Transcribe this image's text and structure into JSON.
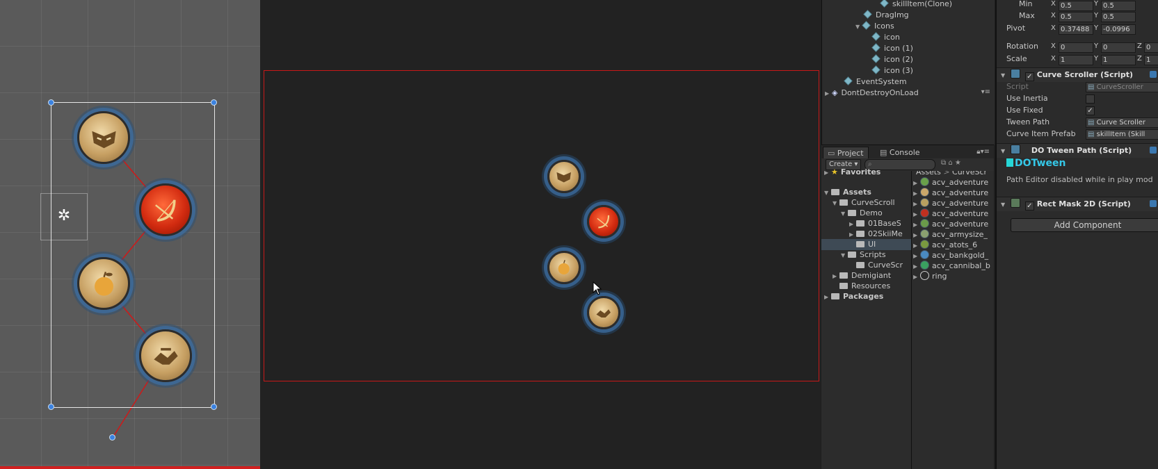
{
  "hierarchy": {
    "items": [
      {
        "label": "skillItem(Clone)",
        "icon": "cube-icon"
      },
      {
        "label": "DragImg",
        "icon": "cube-icon"
      },
      {
        "label": "Icons",
        "icon": "cube-icon"
      },
      {
        "label": "icon",
        "icon": "cube-icon"
      },
      {
        "label": "icon (1)",
        "icon": "cube-icon"
      },
      {
        "label": "icon (2)",
        "icon": "cube-icon"
      },
      {
        "label": "icon (3)",
        "icon": "cube-icon"
      },
      {
        "label": "EventSystem",
        "icon": "cube-icon"
      },
      {
        "label": "DontDestroyOnLoad",
        "icon": "unity-scene-icon"
      }
    ]
  },
  "project": {
    "tabs": [
      "Project",
      "Console"
    ],
    "create_label": "Create",
    "favorites": "Favorites",
    "tree": [
      {
        "label": "Assets",
        "bold": true
      },
      {
        "label": "CurveScroll"
      },
      {
        "label": "Demo"
      },
      {
        "label": "01BaseS"
      },
      {
        "label": "02SkiiMe"
      },
      {
        "label": "UI",
        "selected": true
      },
      {
        "label": "Scripts"
      },
      {
        "label": "CurveScr"
      },
      {
        "label": "Demigiant"
      },
      {
        "label": "Resources"
      },
      {
        "label": "Packages",
        "bold": true
      }
    ],
    "breadcrumb": [
      "Assets",
      "CurveScr"
    ],
    "files": [
      {
        "label": "acv_adventure",
        "color": "#6aa04a"
      },
      {
        "label": "acv_adventure",
        "color": "#c9a76a"
      },
      {
        "label": "acv_adventure",
        "color": "#b8a060"
      },
      {
        "label": "acv_adventure",
        "color": "#c03020"
      },
      {
        "label": "acv_adventure",
        "color": "#6a9a4a"
      },
      {
        "label": "acv_armysize_",
        "color": "#8aa070"
      },
      {
        "label": "acv_atots_6",
        "color": "#7a9a40"
      },
      {
        "label": "acv_bankgold_",
        "color": "#4a8ac0"
      },
      {
        "label": "acv_cannibal_b",
        "color": "#3aa060"
      },
      {
        "label": "ring",
        "color": "#2b2b2b"
      }
    ]
  },
  "inspector": {
    "min_label": "Min",
    "min_x": "0.5",
    "min_y": "0.5",
    "max_label": "Max",
    "max_x": "0.5",
    "max_y": "0.5",
    "pivot_label": "Pivot",
    "pivot_x": "0.37488",
    "pivot_y": "-0.0996",
    "rotation_label": "Rotation",
    "rot_x": "0",
    "rot_y": "0",
    "rot_z": "0",
    "scale_label": "Scale",
    "scale_x": "1",
    "scale_y": "1",
    "scale_z": "1",
    "axis_x": "X",
    "axis_y": "Y",
    "axis_z": "Z",
    "curve_scroller": {
      "title": "Curve Scroller (Script)",
      "script_label": "Script",
      "script_value": "CurveScroller",
      "use_inertia_label": "Use Inertia",
      "use_fixed_label": "Use Fixed",
      "tween_path_label": "Tween Path",
      "tween_path_value": "Curve Scroller",
      "curve_item_prefab_label": "Curve Item Prefab",
      "curve_item_prefab_value": "skillItem (Skill"
    },
    "dotween_path": {
      "title": "DO Tween Path (Script)",
      "logo": "DOTween",
      "note": "Path Editor disabled while in play mod"
    },
    "rect_mask": {
      "title": "Rect Mask 2D (Script)"
    },
    "add_component": "Add Component"
  }
}
